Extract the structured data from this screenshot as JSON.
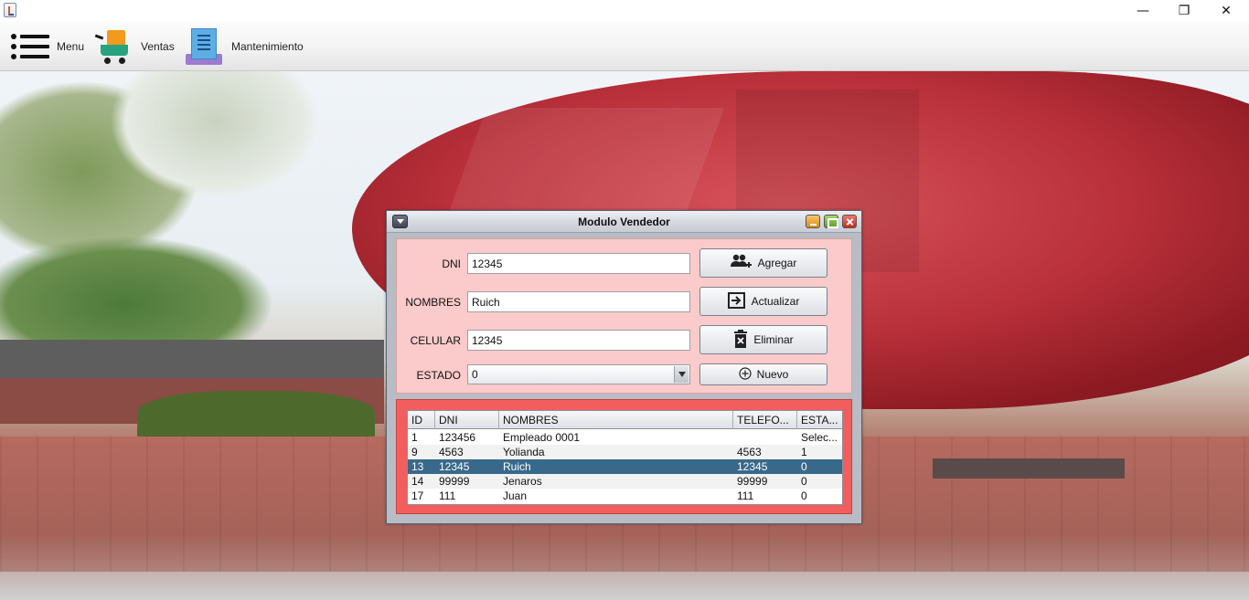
{
  "window": {
    "controls": {
      "minimize": "—",
      "maximize": "❐",
      "close": "✕"
    }
  },
  "menubar": {
    "items": [
      {
        "label": "Menu",
        "icon": "hamburger-menu-icon"
      },
      {
        "label": "Ventas",
        "icon": "shopping-cart-icon"
      },
      {
        "label": "Mantenimiento",
        "icon": "receipt-icon"
      }
    ]
  },
  "dialog": {
    "title": "Modulo Vendedor",
    "form": {
      "dni_label": "DNI",
      "dni_value": "12345",
      "nombres_label": "NOMBRES",
      "nombres_value": "Ruich",
      "celular_label": "CELULAR",
      "celular_value": "12345",
      "estado_label": "ESTADO",
      "estado_value": "0"
    },
    "buttons": {
      "agregar": "Agregar",
      "actualizar": "Actualizar",
      "eliminar": "Eliminar",
      "nuevo": "Nuevo"
    },
    "table": {
      "columns": [
        "ID",
        "DNI",
        "NOMBRES",
        "TELEFO...",
        "ESTA..."
      ],
      "rows": [
        [
          "1",
          "123456",
          "Empleado 0001",
          "",
          "Selec..."
        ],
        [
          "9",
          "4563",
          "Yolianda",
          "4563",
          "1"
        ],
        [
          "13",
          "12345",
          "Ruich",
          "12345",
          "0"
        ],
        [
          "14",
          "99999",
          "Jenaros",
          "99999",
          "0"
        ],
        [
          "17",
          "111",
          "Juan",
          "111",
          "0"
        ]
      ],
      "selected_row": 2
    }
  },
  "colors": {
    "form_panel": "#fbcaca",
    "table_panel": "#f25e5e",
    "selected_row": "#39698a"
  }
}
